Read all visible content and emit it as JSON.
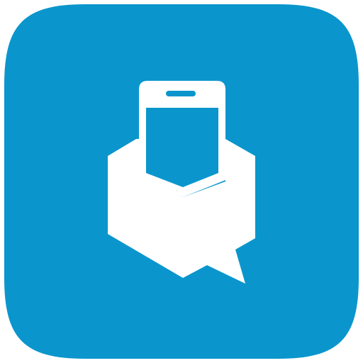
{
  "icon": {
    "name": "messaging-app-icon",
    "depicts": [
      "phone-icon",
      "envelope-icon",
      "speech-bubble-icon"
    ],
    "colors": {
      "tile": "#0A96CD",
      "glyph": "#FFFFFF",
      "background": "#FFFFFF"
    }
  }
}
